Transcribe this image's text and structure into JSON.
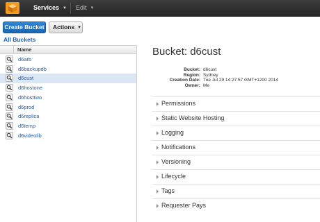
{
  "topbar": {
    "logo_icon": "aws-cube-icon",
    "services_label": "Services",
    "edit_label": "Edit"
  },
  "toolbar": {
    "create_bucket_label": "Create Bucket",
    "actions_label": "Actions"
  },
  "breadcrumb": {
    "all_buckets": "All Buckets"
  },
  "bucket_list": {
    "header": "Name",
    "selected_index": 2,
    "items": [
      "d6arb",
      "d6backupdb",
      "d6cust",
      "d6hostone",
      "d6hosttwo",
      "d6prod",
      "d6replica",
      "d6temp",
      "d6videolib"
    ]
  },
  "detail": {
    "title": "Bucket: d6cust",
    "properties": [
      {
        "key": "Bucket:",
        "value": "d6cust"
      },
      {
        "key": "Region:",
        "value": "Sydney"
      },
      {
        "key": "Creation Date:",
        "value": "Tue Jul 29 14:27:57 GMT+1200 2014"
      },
      {
        "key": "Owner:",
        "value": "Me"
      }
    ],
    "sections": [
      "Permissions",
      "Static Website Hosting",
      "Logging",
      "Notifications",
      "Versioning",
      "Lifecycle",
      "Tags",
      "Requester Pays"
    ]
  },
  "colors": {
    "link": "#1a5fb4",
    "primary_button": "#1f6fc0",
    "selected_row": "#dbe7f5",
    "topbar": "#2f2f2f"
  }
}
